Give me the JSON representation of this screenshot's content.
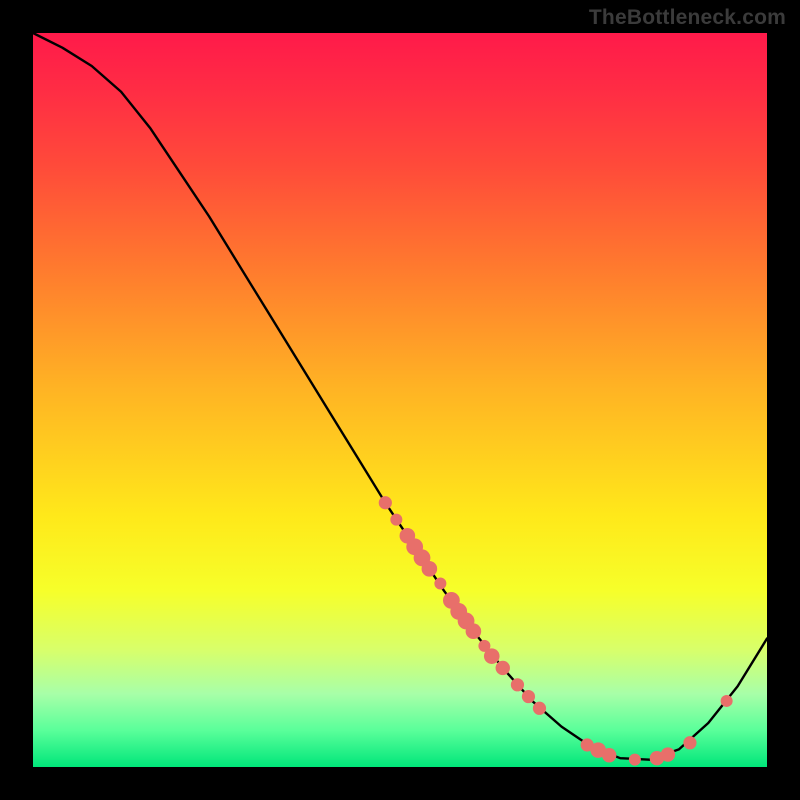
{
  "watermark": "TheBottleneck.com",
  "colors": {
    "background": "#000000",
    "curve": "#000000",
    "dot": "#e86f6a"
  },
  "chart_data": {
    "type": "line",
    "title": "",
    "xlabel": "",
    "ylabel": "",
    "xlim": [
      0,
      100
    ],
    "ylim": [
      0,
      100
    ],
    "grid": false,
    "legend": false,
    "series": [
      {
        "name": "bottleneck-curve",
        "x": [
          0,
          4,
          8,
          12,
          16,
          20,
          24,
          28,
          32,
          36,
          40,
          44,
          48,
          52,
          56,
          60,
          64,
          68,
          72,
          76,
          80,
          84,
          88,
          92,
          96,
          100
        ],
        "y": [
          100,
          98,
          95.5,
          92,
          87,
          81,
          75,
          68.5,
          62,
          55.5,
          49,
          42.5,
          36,
          30,
          24,
          18.5,
          13.5,
          9,
          5.5,
          2.8,
          1.2,
          1,
          2.4,
          6,
          11,
          17.5
        ]
      }
    ],
    "markers": [
      {
        "x": 48,
        "y": 36,
        "r": 1.1
      },
      {
        "x": 49.5,
        "y": 33.7,
        "r": 1.0
      },
      {
        "x": 51,
        "y": 31.5,
        "r": 1.3
      },
      {
        "x": 52,
        "y": 30,
        "r": 1.4
      },
      {
        "x": 53,
        "y": 28.5,
        "r": 1.4
      },
      {
        "x": 54,
        "y": 27,
        "r": 1.3
      },
      {
        "x": 55.5,
        "y": 25,
        "r": 1.0
      },
      {
        "x": 57,
        "y": 22.7,
        "r": 1.4
      },
      {
        "x": 58,
        "y": 21.2,
        "r": 1.4
      },
      {
        "x": 59,
        "y": 19.9,
        "r": 1.4
      },
      {
        "x": 60,
        "y": 18.5,
        "r": 1.3
      },
      {
        "x": 61.5,
        "y": 16.5,
        "r": 1.0
      },
      {
        "x": 62.5,
        "y": 15.1,
        "r": 1.3
      },
      {
        "x": 64,
        "y": 13.5,
        "r": 1.2
      },
      {
        "x": 66,
        "y": 11.2,
        "r": 1.1
      },
      {
        "x": 67.5,
        "y": 9.6,
        "r": 1.1
      },
      {
        "x": 69,
        "y": 8,
        "r": 1.1
      },
      {
        "x": 75.5,
        "y": 3.0,
        "r": 1.1
      },
      {
        "x": 77,
        "y": 2.3,
        "r": 1.3
      },
      {
        "x": 78.5,
        "y": 1.6,
        "r": 1.2
      },
      {
        "x": 82,
        "y": 1.0,
        "r": 1.0
      },
      {
        "x": 85,
        "y": 1.2,
        "r": 1.2
      },
      {
        "x": 86.5,
        "y": 1.7,
        "r": 1.2
      },
      {
        "x": 89.5,
        "y": 3.3,
        "r": 1.1
      },
      {
        "x": 94.5,
        "y": 9.0,
        "r": 1.0
      }
    ]
  }
}
